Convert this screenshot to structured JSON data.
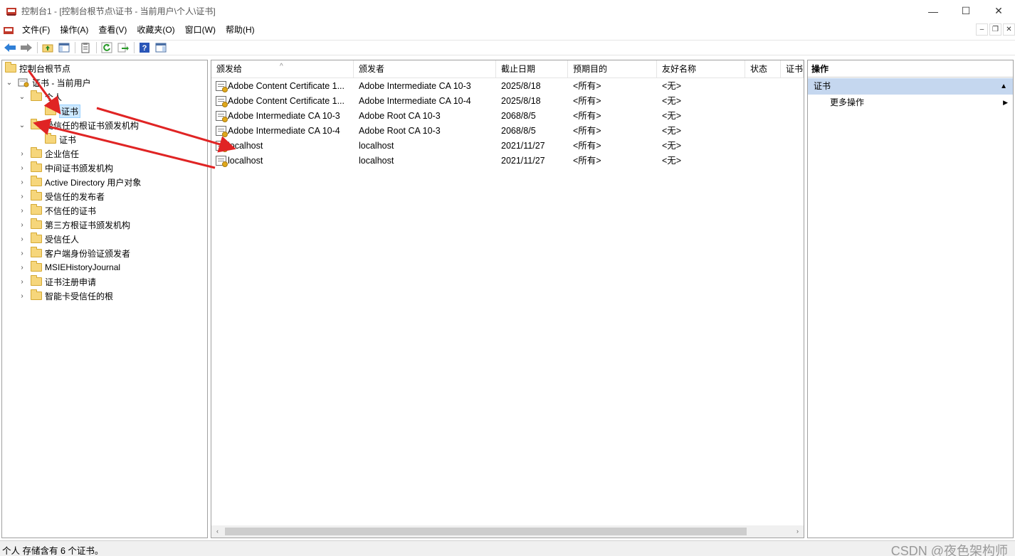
{
  "window": {
    "title": "控制台1 - [控制台根节点\\证书 - 当前用户\\个人\\证书]",
    "controls": {
      "minimize": "—",
      "maximize": "☐",
      "close": "✕"
    }
  },
  "menu": [
    "文件(F)",
    "操作(A)",
    "查看(V)",
    "收藏夹(O)",
    "窗口(W)",
    "帮助(H)"
  ],
  "mdi": {
    "minimize": "–",
    "restore": "❐",
    "close": "✕"
  },
  "toolbar": {
    "icons": [
      "back-arrow-icon",
      "forward-arrow-icon",
      "up-folder-icon",
      "show-tree-icon",
      "properties-icon",
      "refresh-icon",
      "export-icon",
      "help-icon",
      "action-pane-icon"
    ]
  },
  "tree": [
    {
      "label": "控制台根节点",
      "chev": "",
      "icon": "folder"
    },
    {
      "label": "证书 - 当前用户",
      "chev": "⌄",
      "icon": "cert-store"
    },
    {
      "label": "个人",
      "chev": "⌄",
      "icon": "folder"
    },
    {
      "label": "证书",
      "chev": "",
      "icon": "folder",
      "selected": true
    },
    {
      "label": "受信任的根证书颁发机构",
      "chev": "⌄",
      "icon": "folder"
    },
    {
      "label": "证书",
      "chev": "",
      "icon": "folder"
    },
    {
      "label": "企业信任",
      "chev": "›",
      "icon": "folder"
    },
    {
      "label": "中间证书颁发机构",
      "chev": "›",
      "icon": "folder"
    },
    {
      "label": "Active Directory 用户对象",
      "chev": "›",
      "icon": "folder"
    },
    {
      "label": "受信任的发布者",
      "chev": "›",
      "icon": "folder"
    },
    {
      "label": "不信任的证书",
      "chev": "›",
      "icon": "folder"
    },
    {
      "label": "第三方根证书颁发机构",
      "chev": "›",
      "icon": "folder"
    },
    {
      "label": "受信任人",
      "chev": "›",
      "icon": "folder"
    },
    {
      "label": "客户端身份验证颁发者",
      "chev": "›",
      "icon": "folder"
    },
    {
      "label": "MSIEHistoryJournal",
      "chev": "›",
      "icon": "folder"
    },
    {
      "label": "证书注册申请",
      "chev": "›",
      "icon": "folder"
    },
    {
      "label": "智能卡受信任的根",
      "chev": "›",
      "icon": "folder"
    }
  ],
  "list": {
    "columns": [
      "颁发给",
      "颁发者",
      "截止日期",
      "预期目的",
      "友好名称",
      "状态",
      "证书"
    ],
    "sort_indicator": "^",
    "rows": [
      [
        "Adobe Content Certificate 1...",
        "Adobe Intermediate CA 10-3",
        "2025/8/18",
        "<所有>",
        "<无>"
      ],
      [
        "Adobe Content Certificate 1...",
        "Adobe Intermediate CA 10-4",
        "2025/8/18",
        "<所有>",
        "<无>"
      ],
      [
        "Adobe Intermediate CA 10-3",
        "Adobe Root CA 10-3",
        "2068/8/5",
        "<所有>",
        "<无>"
      ],
      [
        "Adobe Intermediate CA 10-4",
        "Adobe Root CA 10-3",
        "2068/8/5",
        "<所有>",
        "<无>"
      ],
      [
        "localhost",
        "localhost",
        "2021/11/27",
        "<所有>",
        "<无>"
      ],
      [
        "localhost",
        "localhost",
        "2021/11/27",
        "<所有>",
        "<无>"
      ]
    ],
    "scroll": {
      "left": "‹",
      "right": "›"
    }
  },
  "actions": {
    "title": "操作",
    "section": "证书",
    "section_toggle": "▲",
    "item": "更多操作",
    "item_arrow": "▶"
  },
  "status": {
    "text": "个人 存储含有 6 个证书。"
  },
  "watermark": "CSDN @夜色架构师",
  "colors": {
    "selection": "#cce8ff",
    "actions_header": "#c5d7ef",
    "annotation_arrow": "#e02424"
  }
}
